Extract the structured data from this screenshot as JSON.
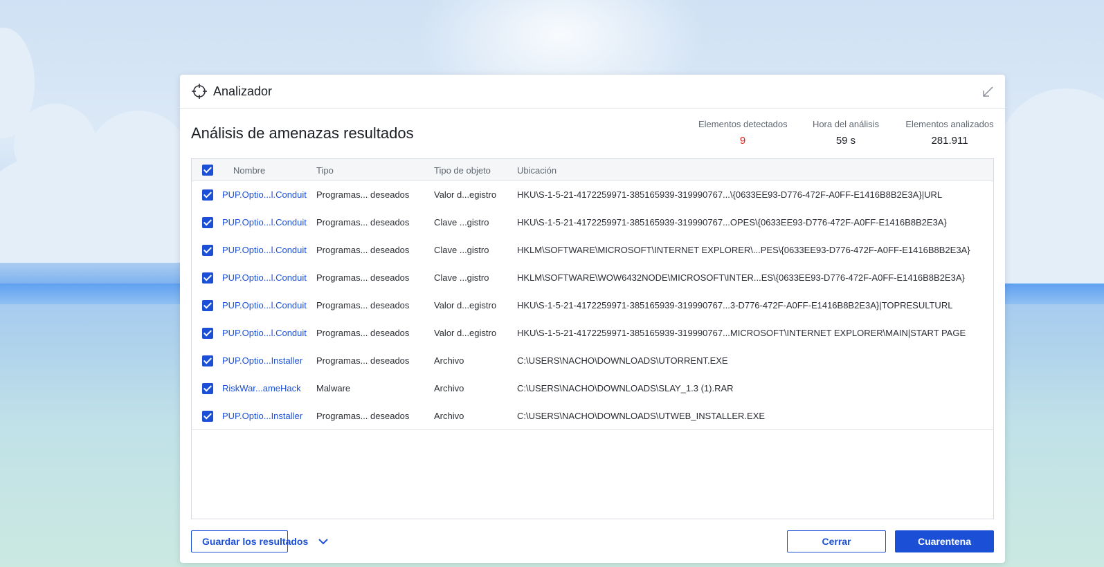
{
  "window": {
    "title": "Analizador"
  },
  "page": {
    "title": "Análisis de amenazas resultados"
  },
  "stats": [
    {
      "label": "Elementos detectados",
      "value": "9",
      "color": "#e0201b"
    },
    {
      "label": "Hora del análisis",
      "value": "59 s"
    },
    {
      "label": "Elementos analizados",
      "value": "281.911"
    }
  ],
  "table": {
    "headers": {
      "name": "Nombre",
      "type": "Tipo",
      "object_type": "Tipo de objeto",
      "location": "Ubicación"
    },
    "rows": [
      {
        "name": "PUP.Optio...l.Conduit",
        "type": "Programas... deseados",
        "object_type": "Valor d...egistro",
        "location": "HKU\\S-1-5-21-4172259971-385165939-319990767...\\{0633EE93-D776-472F-A0FF-E1416B8B2E3A}|URL",
        "checked": true
      },
      {
        "name": "PUP.Optio...l.Conduit",
        "type": "Programas... deseados",
        "object_type": "Clave ...gistro",
        "location": "HKU\\S-1-5-21-4172259971-385165939-319990767...OPES\\{0633EE93-D776-472F-A0FF-E1416B8B2E3A}",
        "checked": true
      },
      {
        "name": "PUP.Optio...l.Conduit",
        "type": "Programas... deseados",
        "object_type": "Clave ...gistro",
        "location": "HKLM\\SOFTWARE\\MICROSOFT\\INTERNET EXPLORER\\...PES\\{0633EE93-D776-472F-A0FF-E1416B8B2E3A}",
        "checked": true
      },
      {
        "name": "PUP.Optio...l.Conduit",
        "type": "Programas... deseados",
        "object_type": "Clave ...gistro",
        "location": "HKLM\\SOFTWARE\\WOW6432NODE\\MICROSOFT\\INTER...ES\\{0633EE93-D776-472F-A0FF-E1416B8B2E3A}",
        "checked": true
      },
      {
        "name": "PUP.Optio...l.Conduit",
        "type": "Programas... deseados",
        "object_type": "Valor d...egistro",
        "location": "HKU\\S-1-5-21-4172259971-385165939-319990767...3-D776-472F-A0FF-E1416B8B2E3A}|TOPRESULTURL",
        "checked": true
      },
      {
        "name": "PUP.Optio...l.Conduit",
        "type": "Programas... deseados",
        "object_type": "Valor d...egistro",
        "location": "HKU\\S-1-5-21-4172259971-385165939-319990767...MICROSOFT\\INTERNET EXPLORER\\MAIN|START PAGE",
        "checked": true
      },
      {
        "name": "PUP.Optio...Installer",
        "type": "Programas... deseados",
        "object_type": "Archivo",
        "location": "C:\\USERS\\NACHO\\DOWNLOADS\\UTORRENT.EXE",
        "checked": true
      },
      {
        "name": "RiskWar...ameHack",
        "type": "Malware",
        "object_type": "Archivo",
        "location": "C:\\USERS\\NACHO\\DOWNLOADS\\SLAY_1.3 (1).RAR",
        "checked": true
      },
      {
        "name": "PUP.Optio...Installer",
        "type": "Programas... deseados",
        "object_type": "Archivo",
        "location": "C:\\USERS\\NACHO\\DOWNLOADS\\UTWEB_INSTALLER.EXE",
        "checked": true
      }
    ]
  },
  "footer": {
    "save_label": "Guardar los resultados",
    "close_label": "Cerrar",
    "quarantine_label": "Cuarentena"
  },
  "colors": {
    "accent": "#1a4fd6",
    "alert": "#e0201b"
  },
  "icons": {
    "app": "crosshair-icon",
    "collapse": "arrow-down-left-icon",
    "dropdown": "chevron-down-icon"
  }
}
